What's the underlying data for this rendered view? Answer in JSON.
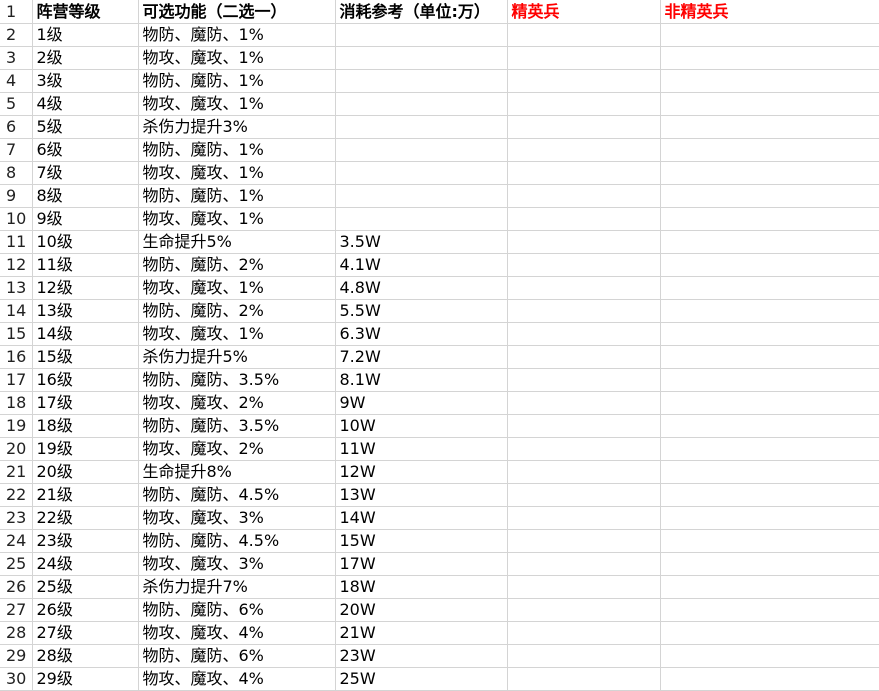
{
  "colors": {
    "header_red": "#ff0000",
    "gridline": "#d4d4d4"
  },
  "headers": {
    "col_a": "阵营等级",
    "col_b": "可选功能（二选一）",
    "col_c": "消耗参考（单位:万）",
    "col_d": "精英兵",
    "col_e": "非精英兵"
  },
  "rows": [
    {
      "n": "1"
    },
    {
      "n": "2",
      "a": "1级",
      "b": "物防、魔防、1%",
      "c": ""
    },
    {
      "n": "3",
      "a": "2级",
      "b": "物攻、魔攻、1%",
      "c": ""
    },
    {
      "n": "4",
      "a": "3级",
      "b": "物防、魔防、1%",
      "c": ""
    },
    {
      "n": "5",
      "a": "4级",
      "b": "物攻、魔攻、1%",
      "c": ""
    },
    {
      "n": "6",
      "a": "5级",
      "b": "杀伤力提升3%",
      "c": ""
    },
    {
      "n": "7",
      "a": "6级",
      "b": "物防、魔防、1%",
      "c": ""
    },
    {
      "n": "8",
      "a": "7级",
      "b": "物攻、魔攻、1%",
      "c": ""
    },
    {
      "n": "9",
      "a": "8级",
      "b": "物防、魔防、1%",
      "c": ""
    },
    {
      "n": "10",
      "a": "9级",
      "b": "物攻、魔攻、1%",
      "c": ""
    },
    {
      "n": "11",
      "a": "10级",
      "b": "生命提升5%",
      "c": "3.5W"
    },
    {
      "n": "12",
      "a": "11级",
      "b": "物防、魔防、2%",
      "c": "4.1W"
    },
    {
      "n": "13",
      "a": "12级",
      "b": "物攻、魔攻、1%",
      "c": "4.8W"
    },
    {
      "n": "14",
      "a": "13级",
      "b": "物防、魔防、2%",
      "c": "5.5W"
    },
    {
      "n": "15",
      "a": "14级",
      "b": "物攻、魔攻、1%",
      "c": "6.3W"
    },
    {
      "n": "16",
      "a": "15级",
      "b": "杀伤力提升5%",
      "c": "7.2W"
    },
    {
      "n": "17",
      "a": "16级",
      "b": "物防、魔防、3.5%",
      "c": "8.1W"
    },
    {
      "n": "18",
      "a": "17级",
      "b": "物攻、魔攻、2%",
      "c": "9W"
    },
    {
      "n": "19",
      "a": "18级",
      "b": "物防、魔防、3.5%",
      "c": "10W"
    },
    {
      "n": "20",
      "a": "19级",
      "b": "物攻、魔攻、2%",
      "c": "11W"
    },
    {
      "n": "21",
      "a": "20级",
      "b": "生命提升8%",
      "c": "12W"
    },
    {
      "n": "22",
      "a": "21级",
      "b": "物防、魔防、4.5%",
      "c": "13W"
    },
    {
      "n": "23",
      "a": "22级",
      "b": "物攻、魔攻、3%",
      "c": "14W"
    },
    {
      "n": "24",
      "a": "23级",
      "b": "物防、魔防、4.5%",
      "c": "15W"
    },
    {
      "n": "25",
      "a": "24级",
      "b": "物攻、魔攻、3%",
      "c": "17W"
    },
    {
      "n": "26",
      "a": "25级",
      "b": "杀伤力提升7%",
      "c": "18W"
    },
    {
      "n": "27",
      "a": "26级",
      "b": "物防、魔防、6%",
      "c": "20W"
    },
    {
      "n": "28",
      "a": "27级",
      "b": "物攻、魔攻、4%",
      "c": "21W"
    },
    {
      "n": "29",
      "a": "28级",
      "b": "物防、魔防、6%",
      "c": "23W"
    },
    {
      "n": "30",
      "a": "29级",
      "b": "物攻、魔攻、4%",
      "c": "25W"
    }
  ]
}
